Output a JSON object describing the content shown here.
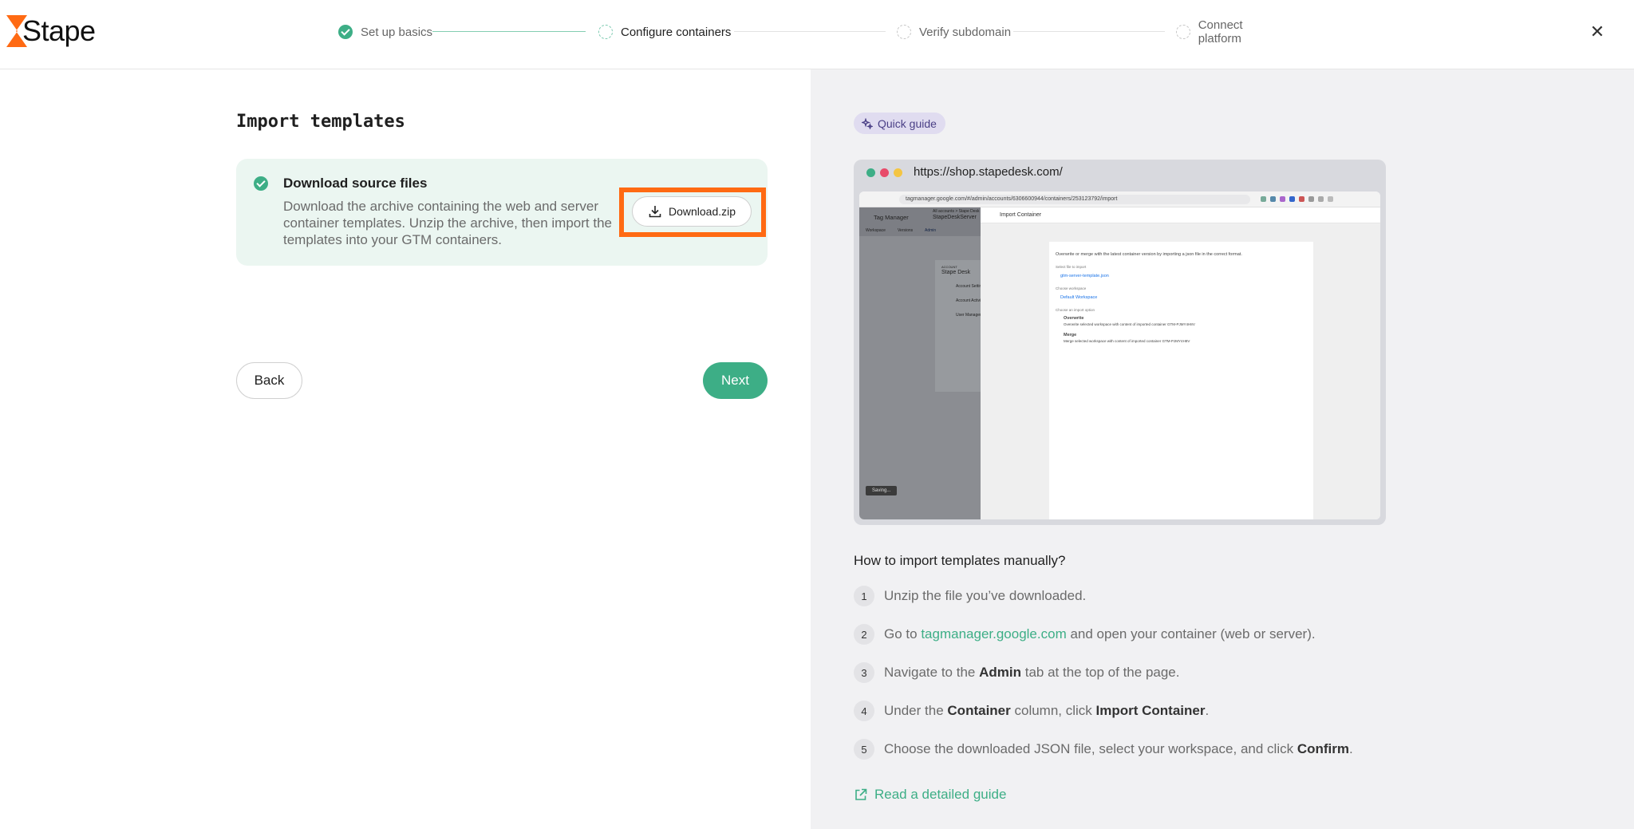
{
  "brand": {
    "name": "Stape",
    "accent": "#3dae86",
    "logo_accent": "#ff6a13"
  },
  "stepper": {
    "steps": [
      {
        "label": "Set up basics",
        "state": "done"
      },
      {
        "label": "Configure containers",
        "state": "active"
      },
      {
        "label": "Verify subdomain",
        "state": "pending"
      },
      {
        "label": "Connect platform",
        "state": "pending"
      }
    ]
  },
  "close": {
    "icon": "close-icon",
    "glyph": "✕"
  },
  "main": {
    "title": "Import templates",
    "card": {
      "title": "Download source files",
      "description": "Download the archive containing the web and server container templates. Unzip the archive, then import the templates into your GTM containers.",
      "download_label": "Download.zip",
      "download_icon": "download-icon"
    },
    "back_label": "Back",
    "next_label": "Next"
  },
  "guide": {
    "badge": "Quick guide",
    "browser_url": "https://shop.stapedesk.com/",
    "screenshot": {
      "url": "tagmanager.google.com/#/admin/accounts/6306600944/containers/253123792/import",
      "app_name": "Tag Manager",
      "container": "StapeDeskServer",
      "account_sub": "All accounts > Stape Desk",
      "nav_tabs": [
        "Workspace",
        "Versions",
        "Admin"
      ],
      "account_label": "ACCOUNT",
      "account_name": "Stape Desk",
      "menu": [
        "Account Settings",
        "Account Activity",
        "User Management"
      ],
      "modal_title": "Import Container",
      "intro": "Overwrite or merge with the latest container version by importing a json file in the correct format.",
      "select_file_label": "Select file to import",
      "file_name": "gtm-server-template.json",
      "workspace_label": "Choose workspace",
      "workspace_value": "Default Workspace",
      "import_option_label": "Choose an import option",
      "overwrite_label": "Overwrite",
      "overwrite_desc": "Overwrite selected workspace with content of imported container GTM-PJMY4H8V",
      "merge_label": "Merge",
      "merge_desc": "Merge selected workspace with content of imported container GTM-PJMY4H8V",
      "saving": "Saving..."
    },
    "how_title": "How to import templates manually?",
    "steps": [
      {
        "num": "1",
        "text": "Unzip the file you’ve downloaded."
      },
      {
        "num": "2",
        "pre": "Go to ",
        "link": "tagmanager.google.com",
        "post": " and open your container (web or server)."
      },
      {
        "num": "3",
        "pre": "Navigate to the ",
        "bold": "Admin",
        "post": " tab at the top of the page."
      },
      {
        "num": "4",
        "pre": "Under the ",
        "bold": "Container",
        "mid": " column, click ",
        "bold2": "Import Container",
        "post": "."
      },
      {
        "num": "5",
        "pre": "Choose the downloaded JSON file, select your workspace, and click ",
        "bold": "Confirm",
        "post": "."
      }
    ],
    "read_more": "Read a detailed guide"
  }
}
